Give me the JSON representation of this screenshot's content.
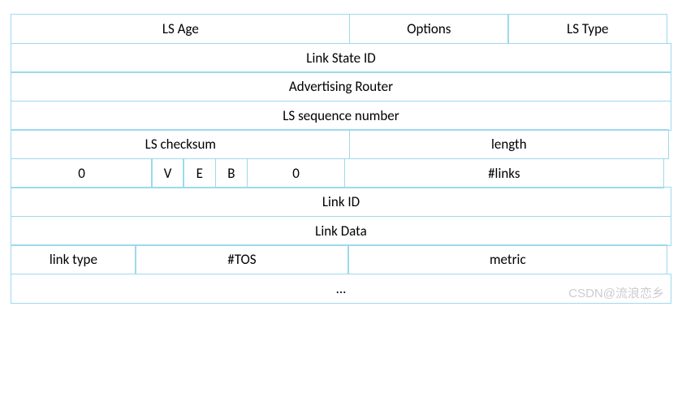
{
  "header": {
    "ls_age": "LS Age",
    "options": "Options",
    "ls_type": "LS Type"
  },
  "link_state_id": "Link State ID",
  "advertising_router": "Advertising Router",
  "ls_sequence": "LS sequence number",
  "checksum_row": {
    "checksum": "LS checksum",
    "length": "length"
  },
  "flags_row": {
    "zero1": "0",
    "v": "V",
    "e": "E",
    "b": "B",
    "zero2": "0",
    "num_links": "#links"
  },
  "link_id": "Link ID",
  "link_data": "Link Data",
  "link_row": {
    "link_type": "link type",
    "tos": "#TOS",
    "metric": "metric"
  },
  "ellipsis": "...",
  "watermark": "CSDN@流浪恋乡"
}
